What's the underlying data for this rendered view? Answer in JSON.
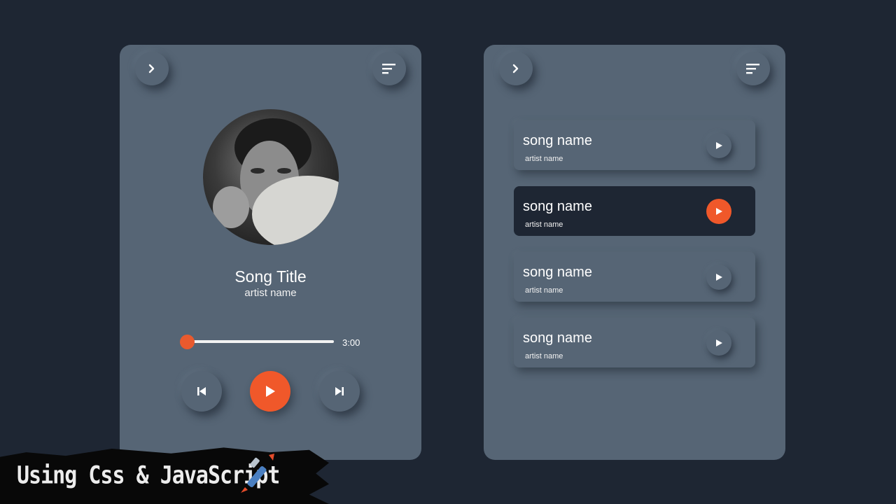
{
  "player": {
    "title": "Song Title",
    "artist": "artist name",
    "duration": "3:00",
    "progress_fraction": 0.0
  },
  "playlist": {
    "items": [
      {
        "name": "song name",
        "artist": "artist name",
        "active": false
      },
      {
        "name": "song name",
        "artist": "artist name",
        "active": true
      },
      {
        "name": "song name",
        "artist": "artist name",
        "active": false
      },
      {
        "name": "song name",
        "artist": "artist name",
        "active": false
      }
    ]
  },
  "banner": {
    "text": "Using Css & JavaScript"
  },
  "icons": [
    "chevron-right-icon",
    "menu-icon",
    "play-icon",
    "previous-icon",
    "next-icon",
    "paintbrush-icon"
  ],
  "colors": {
    "background": "#1e2633",
    "card": "#566575",
    "accent": "#f0582a",
    "active_item": "#1e2633"
  }
}
